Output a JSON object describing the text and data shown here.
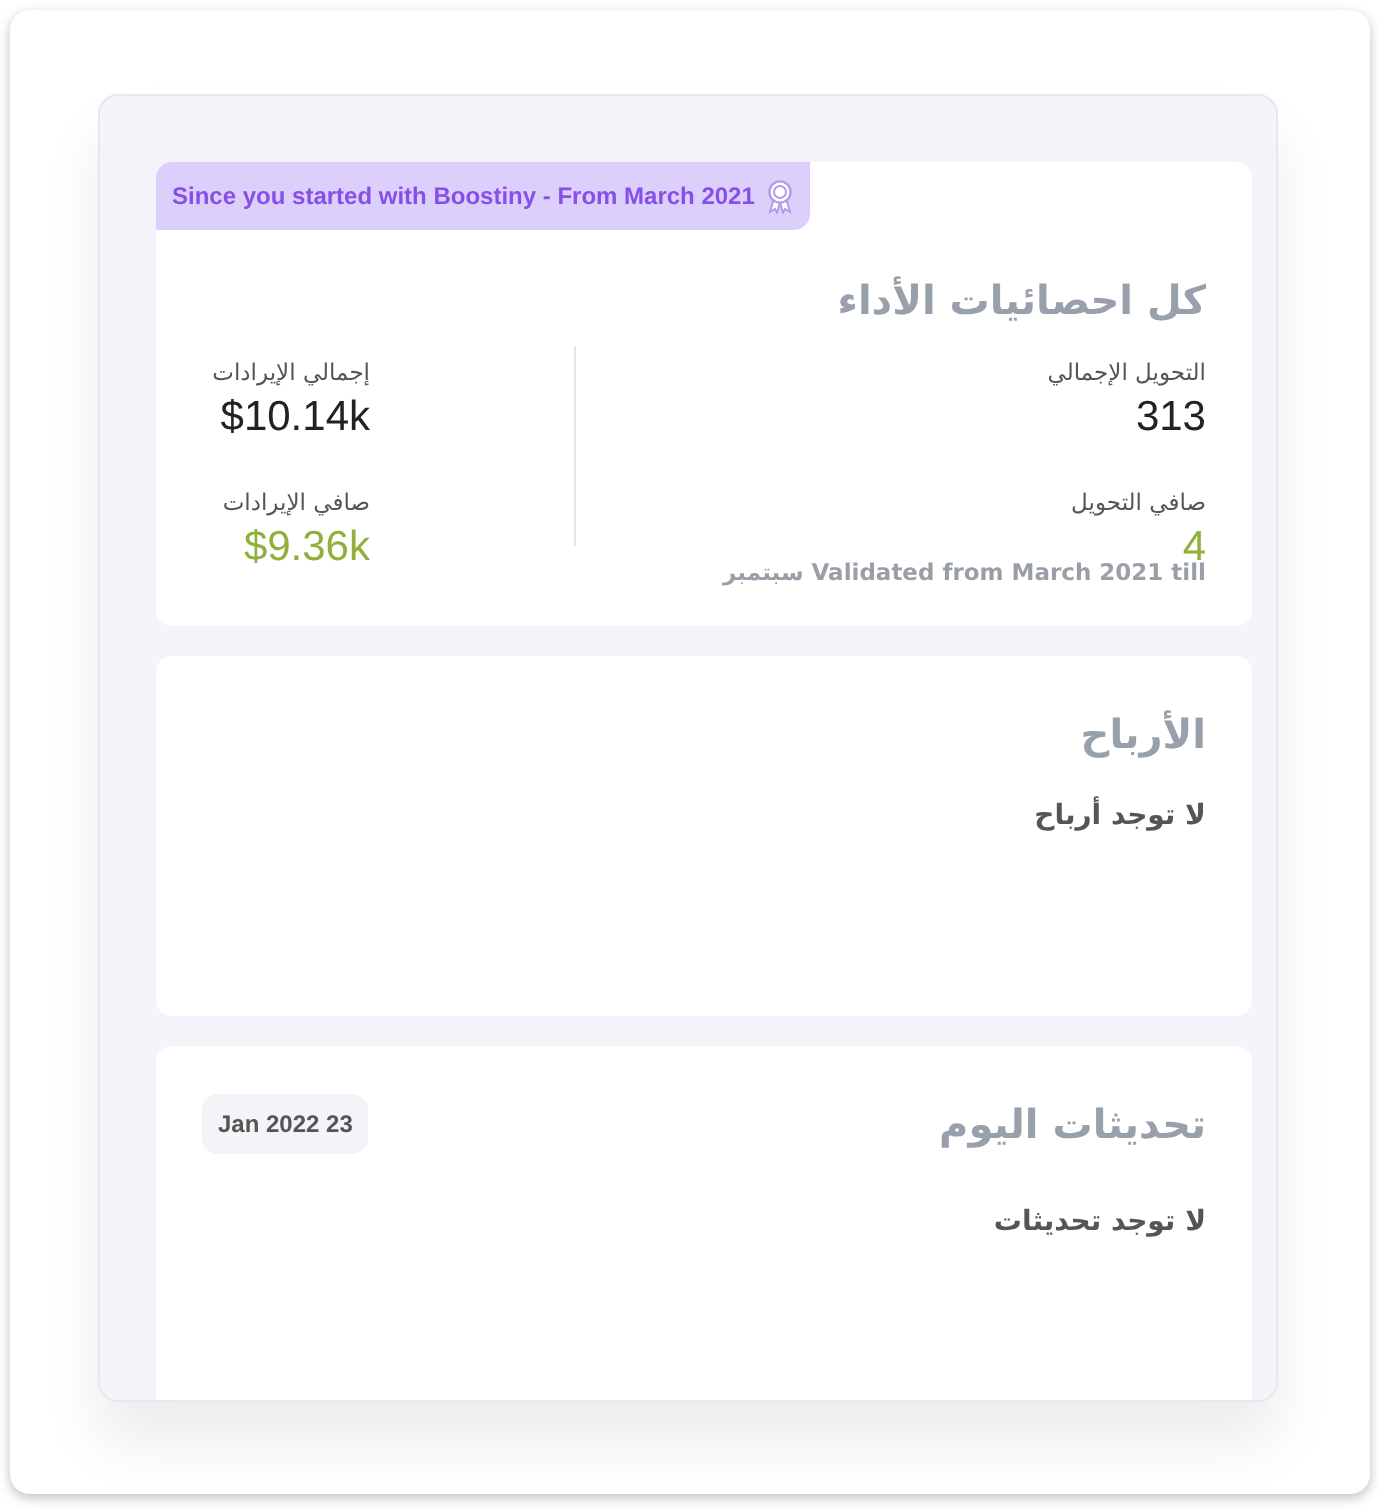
{
  "performance": {
    "banner": "Since you started with Boostiny - From March 2021",
    "title": "كل احصائيات الأداء",
    "conversions": [
      {
        "kind": "total",
        "label": "التحويل الإجمالي",
        "value": "313"
      },
      {
        "kind": "net",
        "label": "صافي التحويل",
        "value": "4"
      }
    ],
    "validated_note": "Validated from March 2021 till سبتمبر",
    "revenues": [
      {
        "kind": "total",
        "label": "إجمالي الإيرادات",
        "value": "$10.14k"
      },
      {
        "kind": "net",
        "label": "صافي الإيرادات",
        "value": "$9.36k"
      }
    ]
  },
  "profits": {
    "title": "الأرباح",
    "empty_text": "لا توجد أرباح"
  },
  "updates": {
    "title": "تحديثات اليوم",
    "date": "Jan 2022 23",
    "empty_text": "لا توجد تحديثات"
  }
}
